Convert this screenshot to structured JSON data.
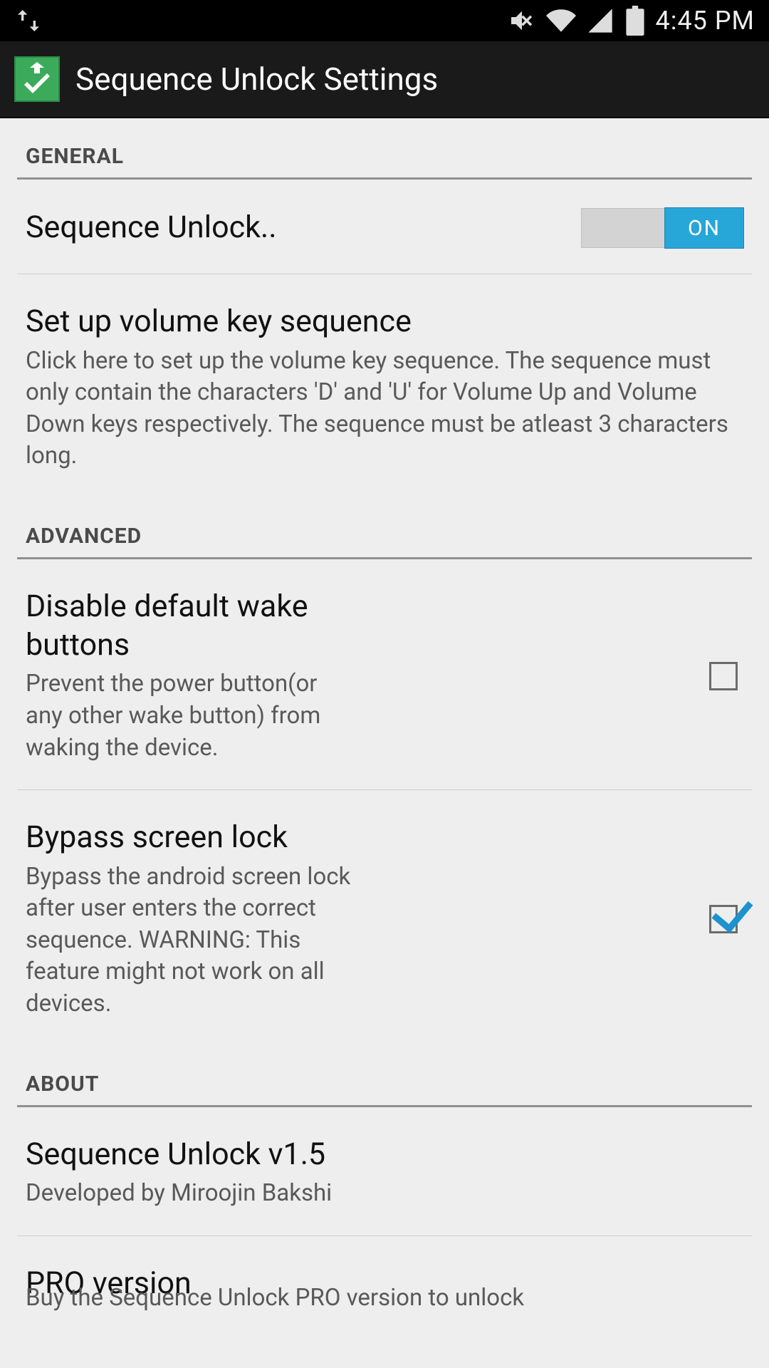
{
  "status": {
    "time": "4:45 PM"
  },
  "header": {
    "title": "Sequence Unlock Settings"
  },
  "sections": {
    "general": {
      "label": "GENERAL",
      "sequence_unlock": {
        "title": "Sequence Unlock..",
        "switch_label": "ON",
        "enabled": true
      },
      "setup": {
        "title": "Set up volume key sequence",
        "summary": "Click here to set up the volume key sequence. The sequence must only contain the characters 'D' and 'U' for Volume Up and Volume Down keys respectively. The sequence must be atleast 3 characters long."
      }
    },
    "advanced": {
      "label": "ADVANCED",
      "disable_wake": {
        "title": "Disable default wake buttons",
        "summary": "Prevent the power button(or any other wake button) from waking the device.",
        "checked": false
      },
      "bypass": {
        "title": "Bypass screen lock",
        "summary": "Bypass the android screen lock after user enters the correct sequence. WARNING: This feature might not work on all devices.",
        "checked": true
      }
    },
    "about": {
      "label": "ABOUT",
      "version": {
        "title": "Sequence Unlock v1.5",
        "summary": "Developed by Miroojin Bakshi"
      },
      "pro": {
        "title": "PRO version",
        "summary": "Buy the Sequence Unlock PRO version to unlock"
      }
    }
  }
}
